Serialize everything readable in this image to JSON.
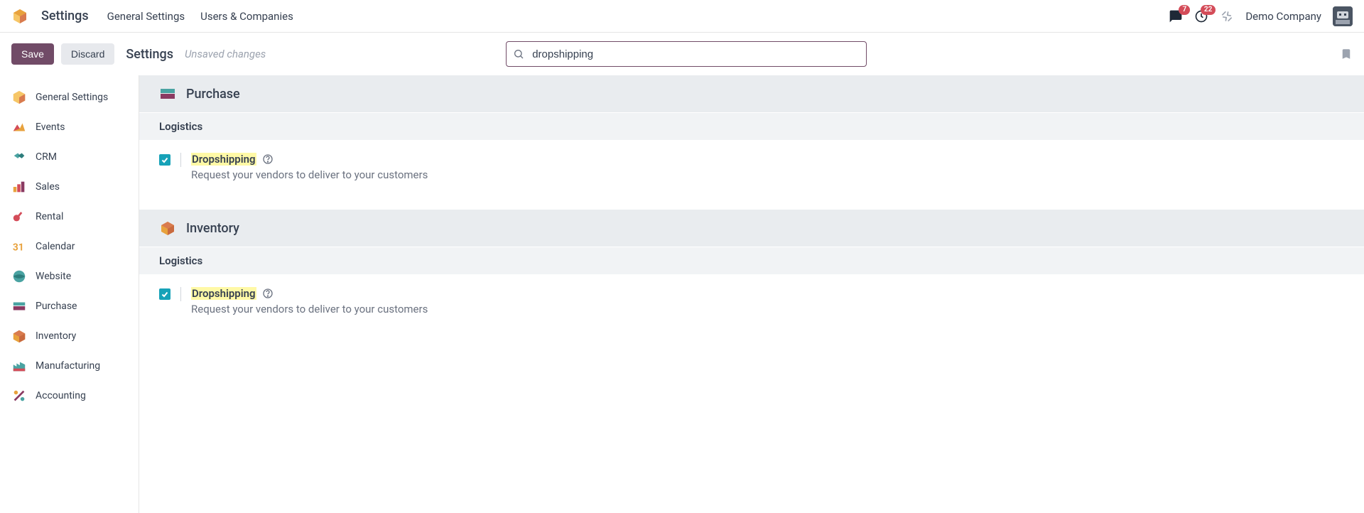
{
  "topnav": {
    "app_title": "Settings",
    "menu": [
      "General Settings",
      "Users & Companies"
    ],
    "messages_badge": "7",
    "activities_badge": "22",
    "company": "Demo Company"
  },
  "controlbar": {
    "save": "Save",
    "discard": "Discard",
    "breadcrumb": "Settings",
    "unsaved": "Unsaved changes",
    "search_value": "dropshipping"
  },
  "sidebar": {
    "items": [
      {
        "label": "General Settings"
      },
      {
        "label": "Events"
      },
      {
        "label": "CRM"
      },
      {
        "label": "Sales"
      },
      {
        "label": "Rental"
      },
      {
        "label": "Calendar"
      },
      {
        "label": "Website"
      },
      {
        "label": "Purchase"
      },
      {
        "label": "Inventory"
      },
      {
        "label": "Manufacturing"
      },
      {
        "label": "Accounting"
      }
    ]
  },
  "content": {
    "modules": [
      {
        "title": "Purchase",
        "section": "Logistics",
        "setting_title": "Dropshipping",
        "setting_desc": "Request your vendors to deliver to your customers"
      },
      {
        "title": "Inventory",
        "section": "Logistics",
        "setting_title": "Dropshipping",
        "setting_desc": "Request your vendors to deliver to your customers"
      }
    ]
  }
}
